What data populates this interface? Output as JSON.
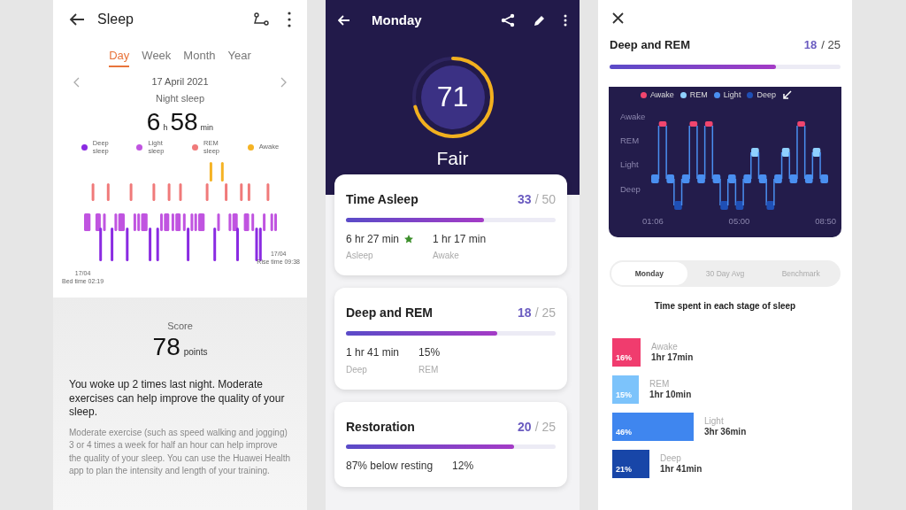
{
  "sleep_screen": {
    "title": "Sleep",
    "tabs": [
      {
        "label": "Day",
        "selected": true
      },
      {
        "label": "Week",
        "selected": false
      },
      {
        "label": "Month",
        "selected": false
      },
      {
        "label": "Year",
        "selected": false
      }
    ],
    "date": "17 April 2021",
    "period": "Night sleep",
    "hours": "6",
    "hours_unit": "h",
    "minutes": "58",
    "minutes_unit": "min",
    "legend": [
      {
        "label": "Deep sleep",
        "color": "#8a2be2"
      },
      {
        "label": "Light sleep",
        "color": "#c054e0"
      },
      {
        "label": "REM sleep",
        "color": "#f07a7a"
      },
      {
        "label": "Awake",
        "color": "#f5b324"
      }
    ],
    "bed_date": "17/04",
    "bed_time": "Bed time 02:19",
    "rise_date": "17/04",
    "rise_time": "Rise time 09:38",
    "score_label": "Score",
    "score": "78",
    "score_unit": "points",
    "headline": "You woke up 2 times last night. Moderate exercises can help improve the quality of your sleep.",
    "advice": "Moderate exercise (such as speed walking and jogging) 3 or 4 times a week for half an hour can help improve the quality of your sleep. You can use the Huawei Health app to plan the intensity and length of your training."
  },
  "score_screen": {
    "title": "Monday",
    "score": "71",
    "rating": "Fair",
    "cards": [
      {
        "title": "Time Asleep",
        "score": "33",
        "total": "/ 50",
        "level": 0.66,
        "stats": [
          {
            "value": "6 hr 27 min",
            "label": "Asleep",
            "starred": true
          },
          {
            "value": "1 hr 17 min",
            "label": "Awake",
            "starred": false
          }
        ]
      },
      {
        "title": "Deep and REM",
        "score": "18",
        "total": "/ 25",
        "level": 0.72,
        "stats": [
          {
            "value": "1 hr 41 min",
            "label": "Deep",
            "starred": false
          },
          {
            "value": "15%",
            "label": "REM",
            "starred": false
          }
        ]
      },
      {
        "title": "Restoration",
        "score": "20",
        "total": "/ 25",
        "level": 0.8,
        "stats": [
          {
            "value": "87% below resting",
            "starred": false
          },
          {
            "value": "12%",
            "starred": false
          }
        ]
      }
    ]
  },
  "detail_screen": {
    "title": "Deep and REM",
    "score": "18",
    "total": "/ 25",
    "level": 0.72,
    "legend": [
      {
        "label": "Awake",
        "color": "#f0456e"
      },
      {
        "label": "REM",
        "color": "#8fd0ff"
      },
      {
        "label": "Light",
        "color": "#4a8ff0"
      },
      {
        "label": "Deep",
        "color": "#1f4fb5"
      }
    ],
    "y_labels": [
      "Awake",
      "REM",
      "Light",
      "Deep"
    ],
    "x_labels": [
      "01:06",
      "05:00",
      "08:50"
    ],
    "segments": [
      {
        "label": "Monday",
        "selected": true
      },
      {
        "label": "30 Day Avg",
        "selected": false
      },
      {
        "label": "Benchmark",
        "selected": false
      }
    ],
    "breakdown_title": "Time spent in each stage of sleep",
    "stages": [
      {
        "label": "Awake",
        "duration": "1hr 17min",
        "percent": "16%",
        "color": "#f03c6e"
      },
      {
        "label": "REM",
        "duration": "1hr 10min",
        "percent": "15%",
        "color": "#7cc3fb"
      },
      {
        "label": "Light",
        "duration": "3hr 36min",
        "percent": "46%",
        "color": "#3f86ef"
      },
      {
        "label": "Deep",
        "duration": "1hr 41min",
        "percent": "21%",
        "color": "#1846a8"
      }
    ]
  }
}
